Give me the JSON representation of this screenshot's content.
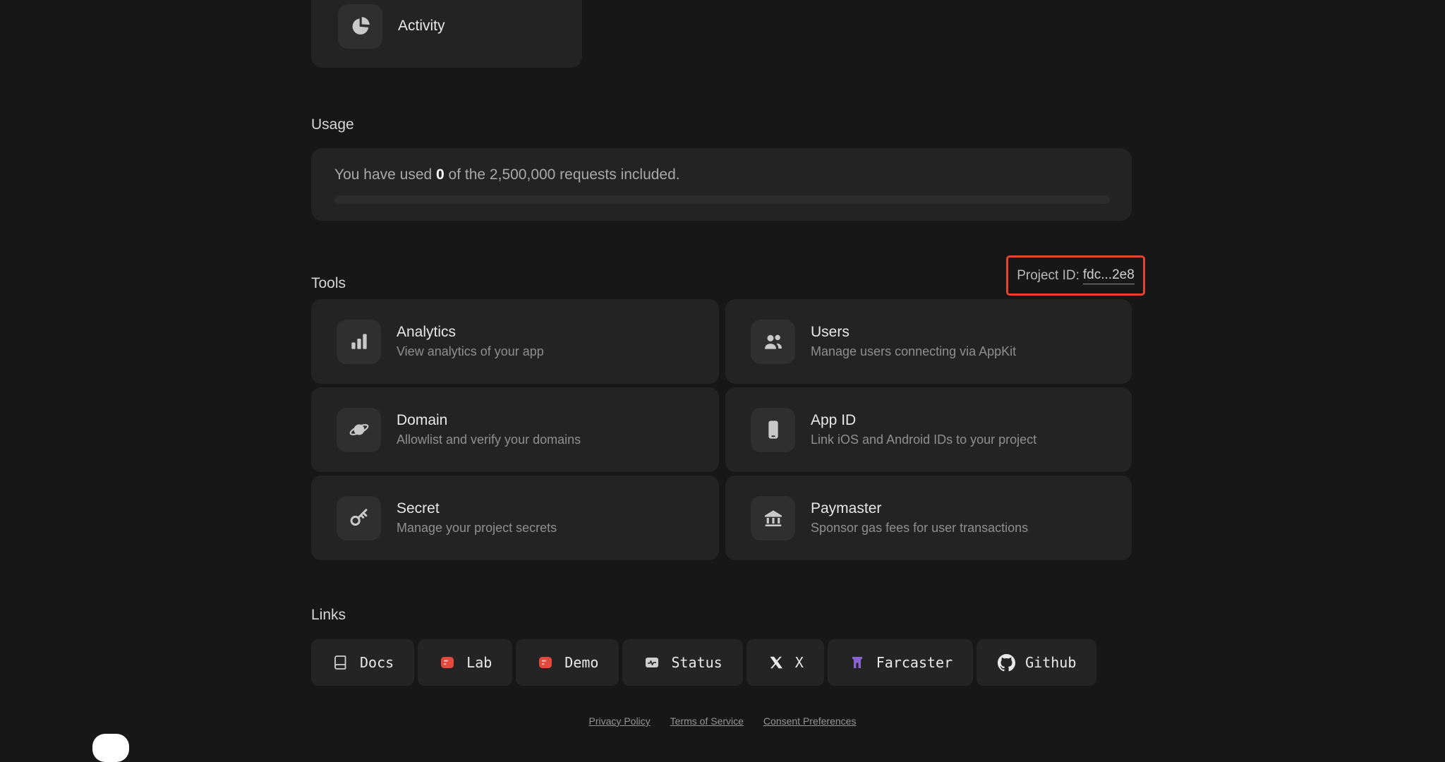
{
  "activity": {
    "label": "Activity",
    "icon": "pie-chart-icon"
  },
  "usage": {
    "heading": "Usage",
    "text_prefix": "You have used ",
    "used": "0",
    "text_suffix": " of the 2,500,000 requests included.",
    "progress_percent": 0
  },
  "tools": {
    "heading": "Tools",
    "project_id_label": "Project ID:",
    "project_id_value": "fdc...2e8",
    "highlight_color": "#e5432d",
    "cards": [
      {
        "title": "Analytics",
        "subtitle": "View analytics of your app",
        "icon": "bar-chart-icon"
      },
      {
        "title": "Users",
        "subtitle": "Manage users connecting via AppKit",
        "icon": "users-icon"
      },
      {
        "title": "Domain",
        "subtitle": "Allowlist and verify your domains",
        "icon": "planet-icon"
      },
      {
        "title": "App ID",
        "subtitle": "Link iOS and Android IDs to your project",
        "icon": "smartphone-icon"
      },
      {
        "title": "Secret",
        "subtitle": "Manage your project secrets",
        "icon": "key-icon"
      },
      {
        "title": "Paymaster",
        "subtitle": "Sponsor gas fees for user transactions",
        "icon": "bank-icon"
      }
    ]
  },
  "links": {
    "heading": "Links",
    "items": [
      {
        "label": "Docs",
        "icon": "book-icon"
      },
      {
        "label": "Lab",
        "icon": "lab-icon",
        "icon_color": "#e5483d"
      },
      {
        "label": "Demo",
        "icon": "demo-icon",
        "icon_color": "#e5483d"
      },
      {
        "label": "Status",
        "icon": "status-icon"
      },
      {
        "label": "X",
        "icon": "x-logo-icon"
      },
      {
        "label": "Farcaster",
        "icon": "farcaster-icon",
        "icon_color": "#8a63d2"
      },
      {
        "label": "Github",
        "icon": "github-icon"
      }
    ]
  },
  "footer": {
    "links": [
      "Privacy Policy",
      "Terms of Service",
      "Consent Preferences"
    ]
  }
}
